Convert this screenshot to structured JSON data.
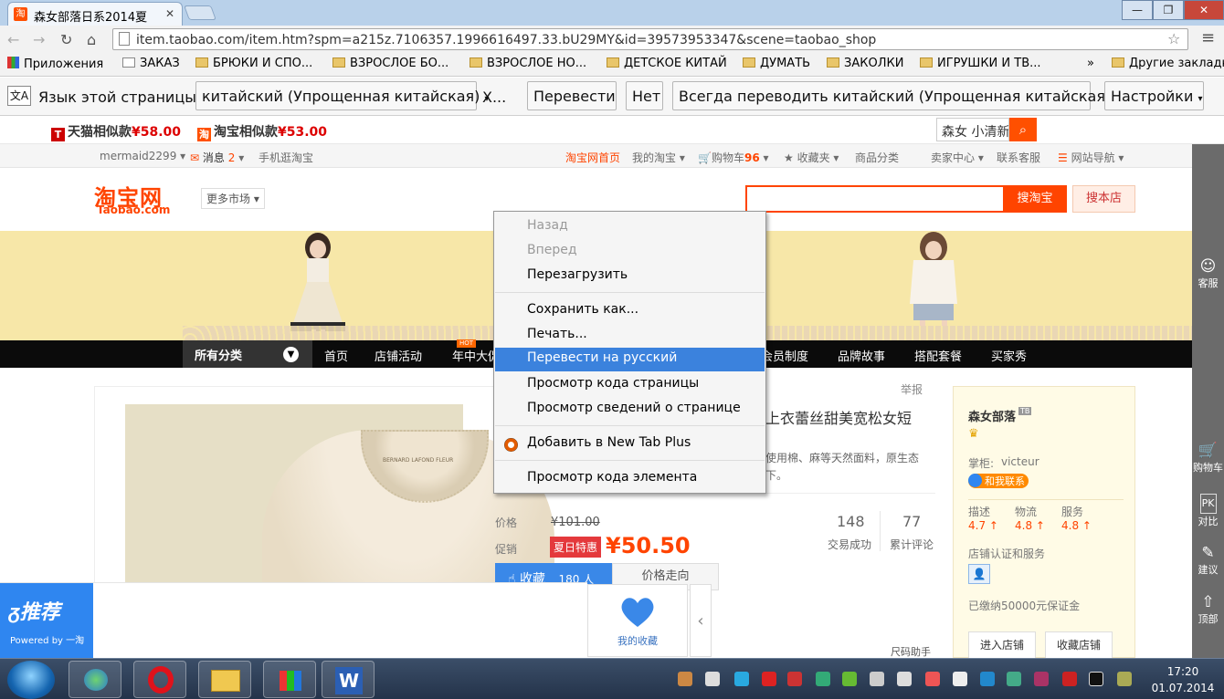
{
  "browser": {
    "tab_title": "森女部落日系2014夏",
    "tab_favicon": "淘",
    "url": "item.taobao.com/item.htm?spm=a215z.7106357.1996616497.33.bU29MY&id=39573953347&scene=taobao_shop"
  },
  "bookmarks": [
    {
      "label": "Приложения",
      "type": "apps"
    },
    {
      "label": "ЗАКАЗ",
      "type": "page"
    },
    {
      "label": "БРЮКИ И СПО...",
      "type": "folder"
    },
    {
      "label": "ВЗРОСЛОЕ БО...",
      "type": "folder"
    },
    {
      "label": "ВЗРОСЛОЕ НО...",
      "type": "folder"
    },
    {
      "label": "ДЕТСКОЕ КИТАЙ",
      "type": "folder"
    },
    {
      "label": "ДУМАТЬ",
      "type": "folder"
    },
    {
      "label": "ЗАКОЛКИ",
      "type": "folder"
    },
    {
      "label": "ИГРУШКИ И ТВ...",
      "type": "folder"
    },
    {
      "label": "»",
      "type": "overflow"
    },
    {
      "label": "Другие закладки",
      "type": "folder"
    }
  ],
  "translate_bar": {
    "prompt": "Язык этой страницы",
    "language": "китайский (Упрощенная китайская)",
    "more": "Х...",
    "translate": "Перевести",
    "no": "Нет",
    "always": "Всегда переводить китайский (Упрощенная китайская)",
    "settings": "Настройки"
  },
  "similar_bar": {
    "tmall_badge": "T",
    "tmall_label": "天猫相似款",
    "tmall_price": "¥58.00",
    "taobao_badge": "淘",
    "taobao_label": "淘宝相似款",
    "taobao_price": "¥53.00",
    "search_value": "森女  小清新"
  },
  "site_nav": {
    "user": "mermaid2299",
    "messages": "消息",
    "messages_count": "2",
    "mobile": "手机逛淘宝",
    "home": "淘宝网首页",
    "my_taobao": "我的淘宝",
    "cart": "购物车",
    "cart_count": "96",
    "favorites": "收藏夹",
    "categories": "商品分类",
    "seller": "卖家中心",
    "service": "联系客服",
    "sitemap": "网站导航"
  },
  "header": {
    "logo": "淘宝网",
    "logo_sub": "Taobao.com",
    "more_markets": "更多市场",
    "search_taobao": "搜淘宝",
    "search_shop": "搜本店"
  },
  "category_nav": {
    "all": "所有分类",
    "hot": "HOT",
    "items": [
      "首页",
      "店铺活动",
      "年中大促",
      "会员制度",
      "品牌故事",
      "搭配套餐",
      "买家秀"
    ]
  },
  "product": {
    "report": "举报",
    "title": "上衣蕾丝甜美宽松女短",
    "desc": "使用棉、麻等天然面料，原生态下。",
    "price_label": "价格",
    "price_orig": "¥101.00",
    "promo_label": "促销",
    "promo_badge": "夏日特惠",
    "promo_price": "¥50.50",
    "sold": "148",
    "sold_label": "交易成功",
    "reviews": "77",
    "reviews_label": "累计评论",
    "fav_label": "收藏",
    "fav_count": "180 人",
    "trend": "价格走向",
    "size_helper": "尺码助手",
    "collar_text": "BERNARD LAFOND FLEUR"
  },
  "shop": {
    "name": "森女部落",
    "name_badge": "TB",
    "keeper_label": "掌柜:",
    "keeper": "victeur",
    "contact": "和我联系",
    "ratings": [
      {
        "label": "描述",
        "value": "4.7"
      },
      {
        "label": "物流",
        "value": "4.8"
      },
      {
        "label": "服务",
        "value": "4.8"
      }
    ],
    "cert": "店铺认证和服务",
    "deposit": "已缴纳50000元保证金",
    "enter": "进入店铺",
    "favorite": "收藏店铺"
  },
  "side_tools": [
    "客服",
    "购物车",
    "对比",
    "建议",
    "顶部"
  ],
  "side_pk": "PK",
  "recommend": {
    "title": "推荐",
    "powered": "Powered by 一淘",
    "my_collection": "我的收藏"
  },
  "context_menu": [
    {
      "label": "Назад",
      "state": "disabled"
    },
    {
      "label": "Вперед",
      "state": "disabled"
    },
    {
      "label": "Перезагрузить",
      "state": "normal"
    },
    {
      "label": "Сохранить как...",
      "state": "normal"
    },
    {
      "label": "Печать...",
      "state": "normal"
    },
    {
      "label": "Перевести на русский",
      "state": "highlighted"
    },
    {
      "label": "Просмотр кода страницы",
      "state": "normal"
    },
    {
      "label": "Просмотр  сведений о странице",
      "state": "normal"
    },
    {
      "label": "Добавить в New Tab Plus",
      "state": "normal"
    },
    {
      "label": "Просмотр кода элемента",
      "state": "normal"
    }
  ],
  "taskbar": {
    "time": "17:20",
    "date": "01.07.2014",
    "pinned_icons": [
      "network-icon",
      "opera-icon",
      "explorer-icon",
      "apps-grid-icon",
      "word-icon"
    ]
  },
  "colors": {
    "taobao_orange": "#ff4400",
    "menu_highlight": "#3b82dd",
    "recommend_blue": "#2f86f0"
  }
}
